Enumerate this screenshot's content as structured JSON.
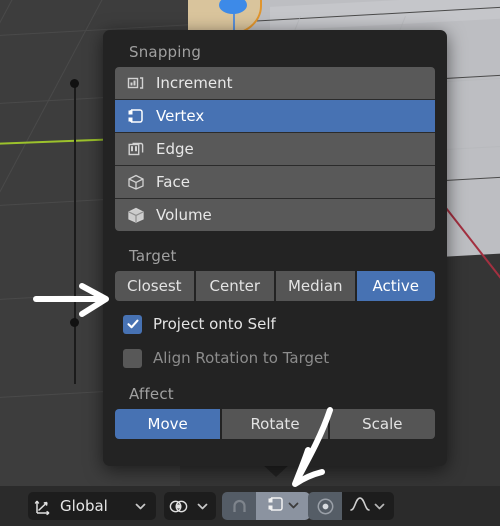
{
  "app": "blender-3d-viewport",
  "panel": {
    "title_snapping": "Snapping",
    "snap_modes": [
      {
        "label": "Increment",
        "icon": "snap-increment-icon",
        "selected": false
      },
      {
        "label": "Vertex",
        "icon": "snap-vertex-icon",
        "selected": true
      },
      {
        "label": "Edge",
        "icon": "snap-edge-icon",
        "selected": false
      },
      {
        "label": "Face",
        "icon": "snap-face-icon",
        "selected": false
      },
      {
        "label": "Volume",
        "icon": "snap-volume-icon",
        "selected": false
      }
    ],
    "title_target": "Target",
    "targets": [
      {
        "label": "Closest",
        "active": false
      },
      {
        "label": "Center",
        "active": false
      },
      {
        "label": "Median",
        "active": false
      },
      {
        "label": "Active",
        "active": true
      }
    ],
    "checkboxes": [
      {
        "label": "Project onto Self",
        "checked": true
      },
      {
        "label": "Align Rotation to Target",
        "checked": false
      }
    ],
    "title_affect": "Affect",
    "affect": [
      {
        "label": "Move",
        "active": true
      },
      {
        "label": "Rotate",
        "active": false
      },
      {
        "label": "Scale",
        "active": false
      }
    ]
  },
  "toolbar": {
    "transform_orientation": {
      "icon": "orientation-axes-icon",
      "value": "Global",
      "dropdown_icon": "chevron-down-icon"
    },
    "pivot_point": {
      "icon": "pivot-point-icon",
      "dropdown_icon": "chevron-down-icon"
    },
    "snap_toggle": {
      "icon": "magnet-icon",
      "enabled": true
    },
    "snap_mode": {
      "icon": "snap-vertex-icon",
      "dropdown_icon": "chevron-down-icon",
      "active": true
    },
    "proportional_editing": {
      "icon": "proportional-editing-icon",
      "enabled": true
    },
    "proportional_falloff": {
      "icon": "smooth-falloff-curve-icon",
      "dropdown_icon": "chevron-down-icon"
    }
  },
  "annotations": [
    {
      "name": "arrow-pointing-to-target-row",
      "direction": "right"
    },
    {
      "name": "arrow-pointing-to-snap-mode-button",
      "direction": "down-left"
    }
  ],
  "colors": {
    "accent_blue": "#4772b3",
    "panel_bg": "#232323",
    "row_bg": "#595959",
    "toolbar_bg": "#2b2b2b",
    "axis_green": "#9cc22c",
    "axis_red": "#a33040",
    "selected_object": "#e0952e"
  }
}
